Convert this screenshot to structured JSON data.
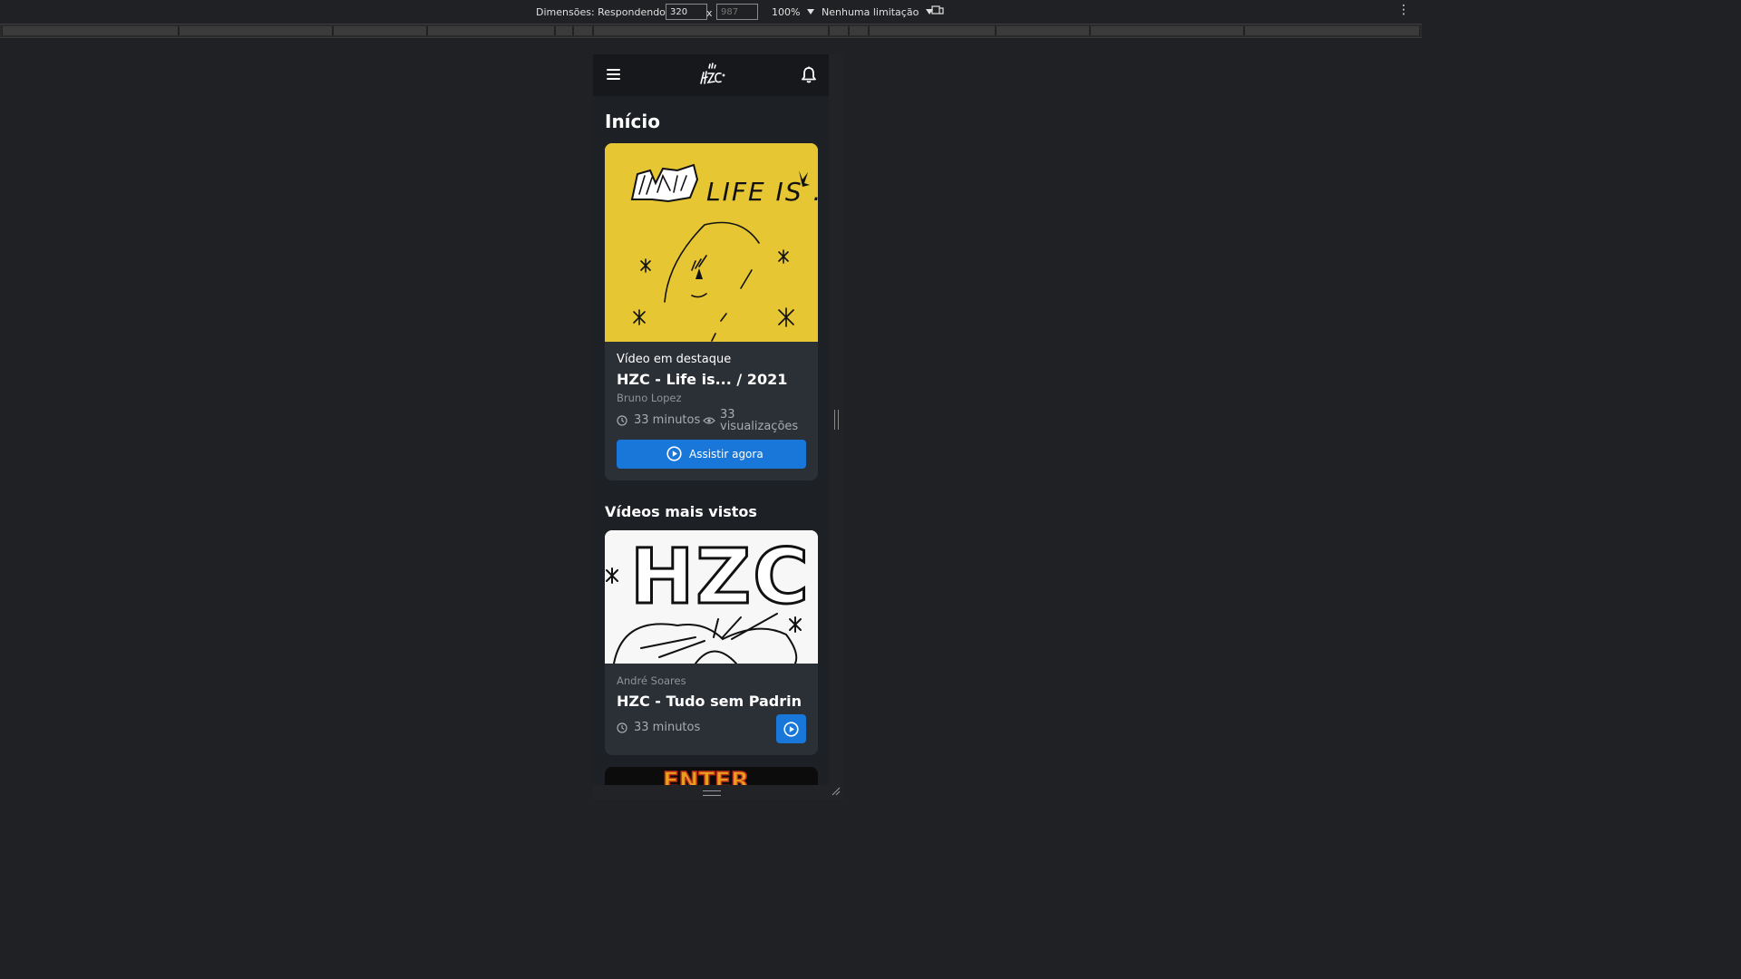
{
  "devtools": {
    "dimensions_label": "Dimensões: Respondendo",
    "width_value": "320",
    "height_placeholder": "987",
    "times": "x",
    "zoom": "100%",
    "throttling": "Nenhuma limitação",
    "more": "⋮"
  },
  "app": {
    "page_title": "Início",
    "featured": {
      "tag": "Vídeo em destaque",
      "title": "HZC - Life is... / 2021",
      "author": "Bruno Lopez",
      "duration": "33 minutos",
      "views_count": "33",
      "views_label": "visualizações",
      "watch_button": "Assistir agora",
      "thumbnail_text": "LIFE IS ..."
    },
    "most_viewed": {
      "heading": "Vídeos mais vistos",
      "items": [
        {
          "author": "André Soares",
          "title": "HZC - Tudo sem Padrin",
          "duration": "33 minutos",
          "thumbnail_text": "HZC"
        },
        {
          "thumbnail_text": "ENTER"
        }
      ]
    }
  },
  "colors": {
    "accent": "#1877d8",
    "featured_bg": "#e6c633",
    "card": "#2b2f36"
  }
}
